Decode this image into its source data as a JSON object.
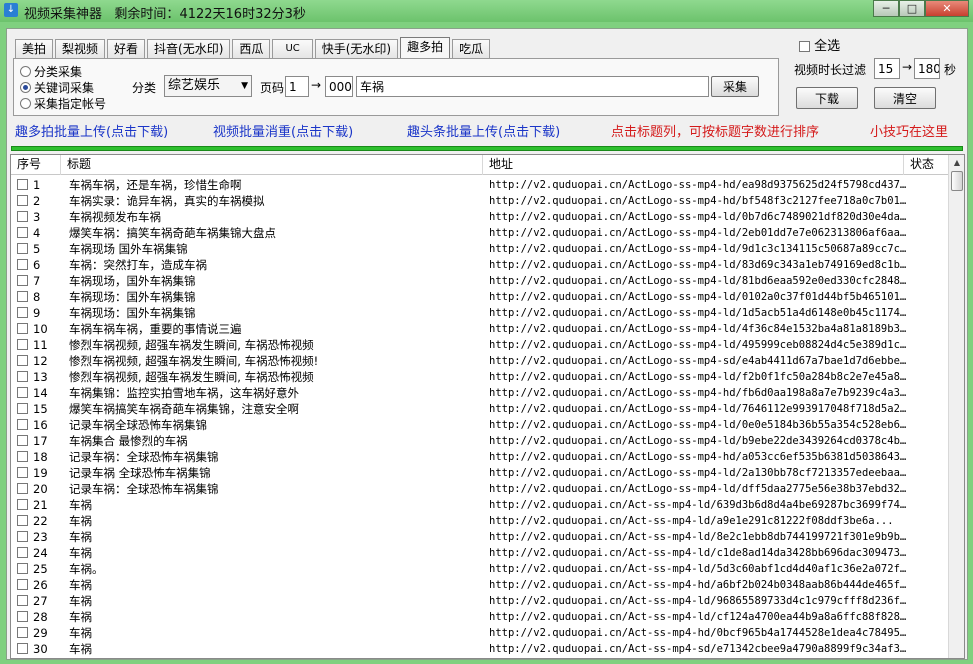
{
  "window": {
    "title": "视频采集神器",
    "remaining_label": "剩余时间：",
    "remaining_value": "4122天16时32分3秒",
    "buttons": {
      "minimize": "─",
      "maximize": "□",
      "close": "✕"
    }
  },
  "tabs": [
    {
      "label": "美拍"
    },
    {
      "label": "梨视频"
    },
    {
      "label": "好看"
    },
    {
      "label": "抖音(无水印)"
    },
    {
      "label": "西瓜"
    },
    {
      "label": "UC"
    },
    {
      "label": "快手(无水印)"
    },
    {
      "label": "趣多拍",
      "active": true
    },
    {
      "label": "吃瓜"
    }
  ],
  "mode": {
    "options": [
      {
        "label": "分类采集",
        "selected": false
      },
      {
        "label": "关键词采集",
        "selected": true
      },
      {
        "label": "采集指定帐号",
        "selected": false
      }
    ]
  },
  "filters": {
    "category_label": "分类",
    "category_value": "综艺娱乐",
    "page_label": "页码",
    "page_from": "1",
    "arrow": "→",
    "page_to": "000",
    "keyword": "车祸",
    "collect_button": "采集"
  },
  "right_panel": {
    "select_all_label": "全选",
    "duration_label": "视频时长过滤",
    "duration_min": "15",
    "duration_arrow": "→",
    "duration_max": "180",
    "duration_unit": "秒",
    "download_button": "下载",
    "clear_button": "清空"
  },
  "links": {
    "batch_upload": "趣多拍批量上传(点击下载)",
    "dedupe": "视频批量消重(点击下载)",
    "toutiao_upload": "趣头条批量上传(点击下载)",
    "sort_tip": "点击标题列，可按标题字数进行排序",
    "tips": "小技巧在这里"
  },
  "colors": {
    "link_blue": "#1a35c8",
    "tip_red": "#d41a1a",
    "progress_green": "#2ec02e",
    "frame_green": "#7fd07f"
  },
  "table": {
    "headers": {
      "num": "序号",
      "title": "标题",
      "url": "地址",
      "status": "状态"
    },
    "rows": [
      {
        "n": "1",
        "title": "车祸车祸，还是车祸，珍惜生命啊",
        "url": "http://v2.quduopai.cn/ActLogo-ss-mp4-hd/ea98d9375625d24f5798cd437..."
      },
      {
        "n": "2",
        "title": "车祸实录：诡异车祸，真实的车祸模拟",
        "url": "http://v2.quduopai.cn/ActLogo-ss-mp4-hd/bf548f3c2127fee718a0c7b01..."
      },
      {
        "n": "3",
        "title": "车祸视频发布车祸",
        "url": "http://v2.quduopai.cn/ActLogo-ss-mp4-ld/0b7d6c7489021df820d30e4da..."
      },
      {
        "n": "4",
        "title": "爆笑车祸：搞笑车祸奇葩车祸集锦大盘点",
        "url": "http://v2.quduopai.cn/ActLogo-ss-mp4-ld/2eb01dd7e7e062313806af6aa..."
      },
      {
        "n": "5",
        "title": "车祸现场 国外车祸集锦",
        "url": "http://v2.quduopai.cn/ActLogo-ss-mp4-ld/9d1c3c134115c50687a89cc7c..."
      },
      {
        "n": "6",
        "title": "车祸：突然打车，造成车祸",
        "url": "http://v2.quduopai.cn/ActLogo-ss-mp4-ld/83d69c343a1eb749169ed8c1b..."
      },
      {
        "n": "7",
        "title": "车祸现场，国外车祸集锦",
        "url": "http://v2.quduopai.cn/ActLogo-ss-mp4-ld/81bd6eaa592e0ed330cfc2848..."
      },
      {
        "n": "8",
        "title": "车祸现场：国外车祸集锦",
        "url": "http://v2.quduopai.cn/ActLogo-ss-mp4-ld/0102a0c37f01d44bf5b465101..."
      },
      {
        "n": "9",
        "title": "车祸现场：国外车祸集锦",
        "url": "http://v2.quduopai.cn/ActLogo-ss-mp4-ld/1d5acb51a4d6148e0b45c1174..."
      },
      {
        "n": "10",
        "title": "车祸车祸车祸，重要的事情说三遍",
        "url": "http://v2.quduopai.cn/ActLogo-ss-mp4-ld/4f36c84e1532ba4a81a8189b3..."
      },
      {
        "n": "11",
        "title": "惨烈车祸视频, 超强车祸发生瞬间, 车祸恐怖视频",
        "url": "http://v2.quduopai.cn/ActLogo-ss-mp4-ld/495999ceb08824d4c5e389d1c..."
      },
      {
        "n": "12",
        "title": "惨烈车祸视频, 超强车祸发生瞬间, 车祸恐怖视频!",
        "url": "http://v2.quduopai.cn/ActLogo-ss-mp4-sd/e4ab4411d67a7bae1d7d6ebbe..."
      },
      {
        "n": "13",
        "title": "惨烈车祸视频, 超强车祸发生瞬间, 车祸恐怖视频",
        "url": "http://v2.quduopai.cn/ActLogo-ss-mp4-ld/f2b0f1fc50a284b8c2e7e45a8..."
      },
      {
        "n": "14",
        "title": "车祸集锦：监控实拍雪地车祸，这车祸好意外",
        "url": "http://v2.quduopai.cn/ActLogo-ss-mp4-hd/fb6d0aa198a8a7e7b9239c4a3..."
      },
      {
        "n": "15",
        "title": "爆笑车祸搞笑车祸奇葩车祸集锦，注意安全啊",
        "url": "http://v2.quduopai.cn/ActLogo-ss-mp4-ld/7646112e993917048f718d5a2..."
      },
      {
        "n": "16",
        "title": "记录车祸全球恐怖车祸集锦",
        "url": "http://v2.quduopai.cn/ActLogo-ss-mp4-ld/0e0e5184b36b55a354c528eb6..."
      },
      {
        "n": "17",
        "title": "车祸集合 最惨烈的车祸",
        "url": "http://v2.quduopai.cn/ActLogo-ss-mp4-ld/b9ebe22de3439264cd0378c4b..."
      },
      {
        "n": "18",
        "title": "记录车祸：全球恐怖车祸集锦",
        "url": "http://v2.quduopai.cn/ActLogo-ss-mp4-hd/a053cc6ef535b6381d5038643..."
      },
      {
        "n": "19",
        "title": "记录车祸 全球恐怖车祸集锦",
        "url": "http://v2.quduopai.cn/ActLogo-ss-mp4-ld/2a130bb78cf7213357edeebaa..."
      },
      {
        "n": "20",
        "title": "记录车祸：全球恐怖车祸集锦",
        "url": "http://v2.quduopai.cn/ActLogo-ss-mp4-ld/dff5daa2775e56e38b37ebd32..."
      },
      {
        "n": "21",
        "title": "车祸",
        "url": "http://v2.quduopai.cn/Act-ss-mp4-ld/639d3b6d8d4a4be69287bc3699f74..."
      },
      {
        "n": "22",
        "title": "车祸",
        "url": "http://v2.quduopai.cn/Act-ss-mp4-ld/a9e1e291c81222f08ddf3be6a..."
      },
      {
        "n": "23",
        "title": "车祸",
        "url": "http://v2.quduopai.cn/Act-ss-mp4-ld/8e2c1ebb8db744199721f301e9b9b..."
      },
      {
        "n": "24",
        "title": "车祸",
        "url": "http://v2.quduopai.cn/Act-ss-mp4-ld/c1de8ad14da3428bb696dac309473..."
      },
      {
        "n": "25",
        "title": "车祸。",
        "url": "http://v2.quduopai.cn/Act-ss-mp4-ld/5d3c60abf1cd4d40af1c36e2a072f..."
      },
      {
        "n": "26",
        "title": "车祸",
        "url": "http://v2.quduopai.cn/Act-ss-mp4-hd/a6bf2b024b0348aab86b444de465f..."
      },
      {
        "n": "27",
        "title": "车祸",
        "url": "http://v2.quduopai.cn/Act-ss-mp4-ld/96865589733d4c1c979cfff8d236f..."
      },
      {
        "n": "28",
        "title": "车祸",
        "url": "http://v2.quduopai.cn/Act-ss-mp4-ld/cf124a4700ea44b9a8a6ffc88f828..."
      },
      {
        "n": "29",
        "title": "车祸",
        "url": "http://v2.quduopai.cn/Act-ss-mp4-hd/0bcf965b4a1744528e1dea4c78495..."
      },
      {
        "n": "30",
        "title": "车祸",
        "url": "http://v2.quduopai.cn/Act-ss-mp4-sd/e71342cbee9a4790a8899f9c34af3..."
      }
    ]
  }
}
